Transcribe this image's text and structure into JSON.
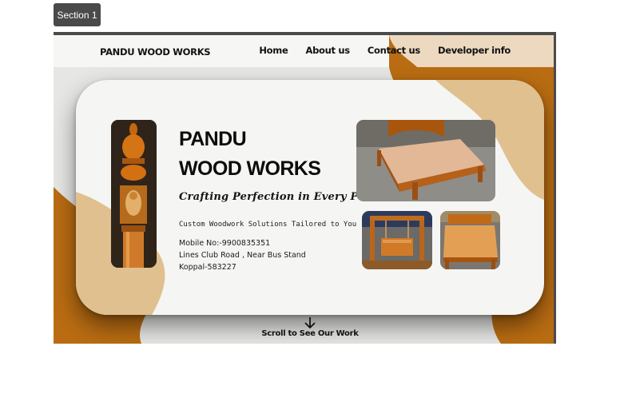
{
  "section_label": "Section 1",
  "navbar": {
    "brand": "PANDU WOOD WORKS",
    "links": [
      "Home",
      "About us",
      "Contact us",
      "Developer info"
    ]
  },
  "hero": {
    "title_line1": "PANDU",
    "title_line2": "WOOD WORKS",
    "tagline": "Crafting Perfection in Every Piece",
    "subtitle": "Custom Woodwork Solutions Tailored to You",
    "mobile": "Mobile No:-9900835351",
    "address_line1": "Lines Club Road , Near Bus Stand",
    "address_line2": "Koppal-583227"
  },
  "scroll_hint": "Scroll to See Our Work",
  "colors": {
    "accent_brown": "#b96c12",
    "accent_tan": "#dfc08e",
    "nav_peach": "#ecd9c0",
    "card_bg": "#f5f5f3"
  },
  "icons": [
    "arrow-down-icon"
  ]
}
